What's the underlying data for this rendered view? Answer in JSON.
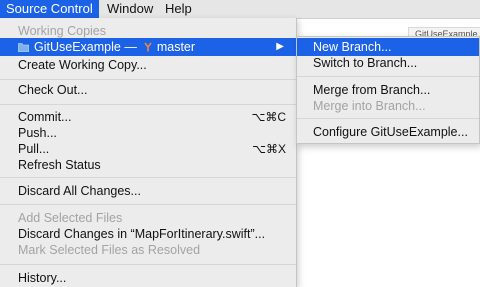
{
  "menubar": {
    "items": [
      "Source Control",
      "Window",
      "Help"
    ]
  },
  "background_tab": "GitUseExample",
  "main_menu": {
    "section_header": "Working Copies",
    "working_copy": {
      "name": "GitUseExample",
      "dash": "—",
      "branch": "master",
      "arrow": "▶"
    },
    "create_working_copy": "Create Working Copy...",
    "check_out": "Check Out...",
    "commit": {
      "label": "Commit...",
      "shortcut": "⌥⌘C"
    },
    "push": "Push...",
    "pull": {
      "label": "Pull...",
      "shortcut": "⌥⌘X"
    },
    "refresh_status": "Refresh Status",
    "discard_all": "Discard All Changes...",
    "add_selected": "Add Selected Files",
    "discard_changes_in": "Discard Changes in “MapForItinerary.swift”...",
    "mark_resolved": "Mark Selected Files as Resolved",
    "history": "History..."
  },
  "sub_menu": {
    "new_branch": "New Branch...",
    "switch_branch": "Switch to Branch...",
    "merge_from": "Merge from Branch...",
    "merge_into": "Merge into Branch...",
    "configure": "Configure GitUseExample..."
  },
  "colors": {
    "highlight": "#1c62e6",
    "menu_bg": "#ececec",
    "disabled_text": "#a3a3a3",
    "folder_icon": "#5b9bd5",
    "branch_icon": "#e8792b"
  }
}
